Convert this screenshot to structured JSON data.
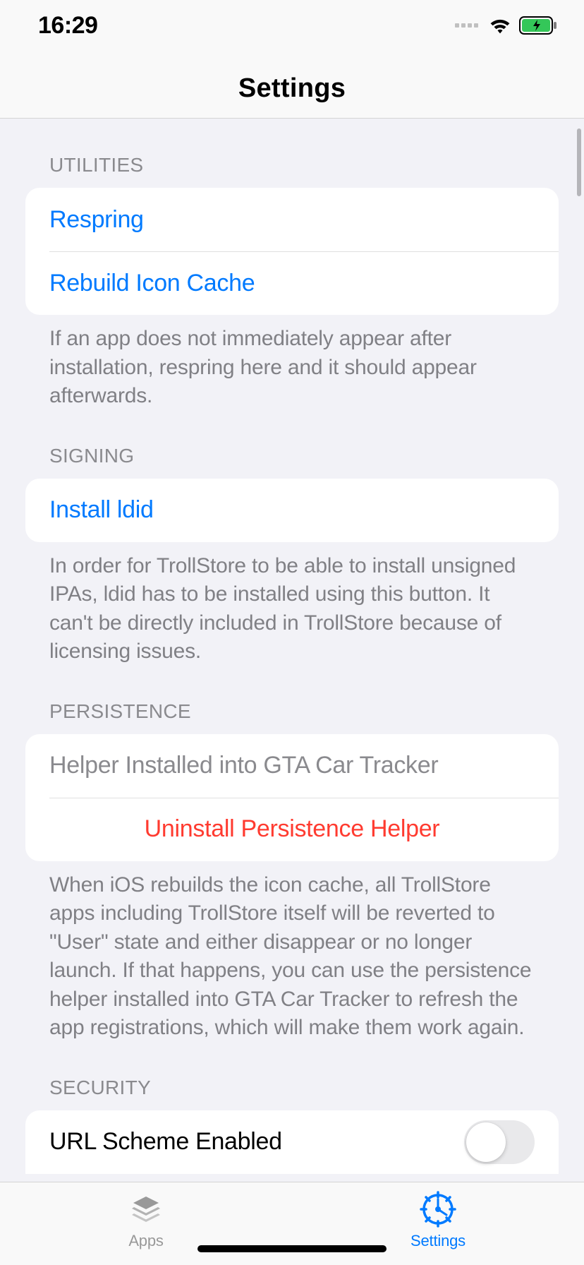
{
  "status": {
    "time": "16:29"
  },
  "header": {
    "title": "Settings"
  },
  "sections": {
    "utilities": {
      "header": "UTILITIES",
      "respring": "Respring",
      "rebuild": "Rebuild Icon Cache",
      "footer": "If an app does not immediately appear after installation, respring here and it should appear afterwards."
    },
    "signing": {
      "header": "SIGNING",
      "install_ldid": "Install ldid",
      "footer": "In order for TrollStore to be able to install unsigned IPAs, ldid has to be installed using this button. It can't be directly included in TrollStore because of licensing issues."
    },
    "persistence": {
      "header": "PERSISTENCE",
      "status": "Helper Installed into GTA Car Tracker",
      "uninstall": "Uninstall Persistence Helper",
      "footer": "When iOS rebuilds the icon cache, all TrollStore apps including TrollStore itself will be reverted to \"User\" state and either disappear or no longer launch. If that happens, you can use the persistence helper installed into GTA Car Tracker to refresh the app registrations, which will make them work again."
    },
    "security": {
      "header": "SECURITY",
      "url_scheme": "URL Scheme Enabled"
    }
  },
  "tabs": {
    "apps": "Apps",
    "settings": "Settings"
  }
}
